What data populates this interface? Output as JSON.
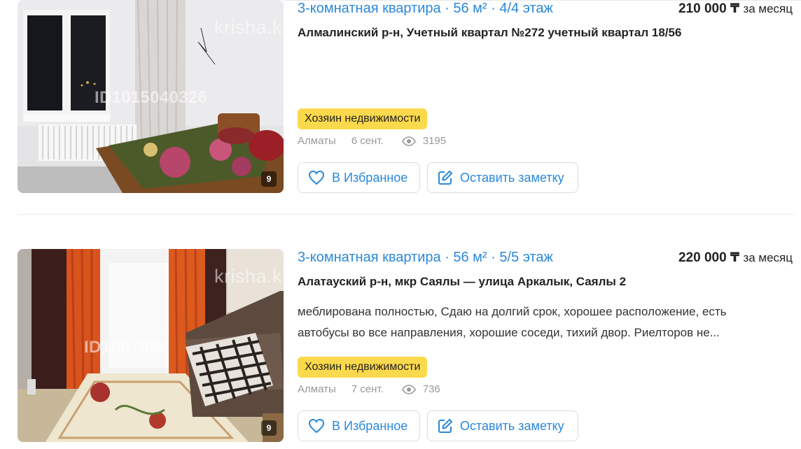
{
  "listings": [
    {
      "title": "3-комнатная квартира · 56 м² · 4/4 этаж",
      "price_amount": "210 000 ₸",
      "price_period": "за месяц",
      "address": "Алмалинский р-н, Учетный квартал №272 учетный квартал 18/56",
      "description": "",
      "badge": "Хозяин недвижимости",
      "city": "Алматы",
      "date": "6 сент.",
      "views": "3195",
      "photo_count": "9",
      "watermark_logo": "krisha.k",
      "watermark_id": "ID1015040326",
      "favorite_label": "В Избранное",
      "note_label": "Оставить заметку"
    },
    {
      "title": "3-комнатная квартира · 56 м² · 5/5 этаж",
      "price_amount": "220 000 ₸",
      "price_period": "за месяц",
      "address": "Алатауский р-н, мкр Саялы — улица Аркалык, Саялы 2",
      "description": "меблирована полностью, Сдаю на долгий срок, хорошее расположение, есть автобусы во все направления, хорошие соседи, тихий двор. Риелторов не...",
      "badge": "Хозяин недвижимости",
      "city": "Алматы",
      "date": "7 сент.",
      "views": "736",
      "photo_count": "9",
      "watermark_logo": "krisha.k",
      "watermark_id": "ID1007966",
      "favorite_label": "В Избранное",
      "note_label": "Оставить заметку"
    }
  ],
  "colors": {
    "link": "#2b88d8",
    "badge": "#fbd94c",
    "meta": "#999999"
  },
  "icons": [
    "heart-icon",
    "edit-note-icon",
    "eye-icon"
  ]
}
